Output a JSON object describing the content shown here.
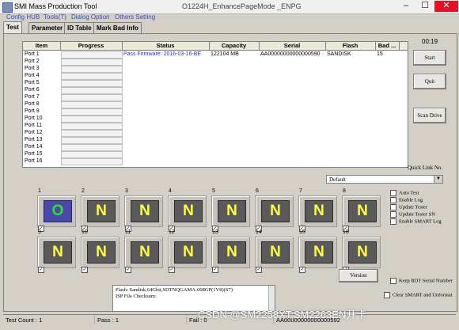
{
  "window": {
    "title": "SMI Mass Production Tool",
    "subtitle": "O1224H_EnhancePageMode      _ENPG"
  },
  "menu": [
    "Config HUB",
    "Tools(T)",
    "Dialog Option",
    "Others Setting"
  ],
  "tabs": [
    "Test",
    "Parameter",
    "ID Table",
    "Mark Bad Info"
  ],
  "table": {
    "headers": [
      "Item",
      "Progress",
      "Status",
      "Capacity",
      "Serial",
      "Flash",
      "Bad ..."
    ],
    "rows": [
      {
        "item": "Port 1",
        "status": "Pass   Firmware: 2016-03-16-BE",
        "capacity": "122104 MB",
        "serial": "AA00000000000000590",
        "flash": "SANDISK",
        "bad": "15"
      },
      {
        "item": "Port 2"
      },
      {
        "item": "Port 3"
      },
      {
        "item": "Port 4"
      },
      {
        "item": "Port 5"
      },
      {
        "item": "Port 6"
      },
      {
        "item": "Port 7"
      },
      {
        "item": "Port 8"
      },
      {
        "item": "Port 9"
      },
      {
        "item": "Port 10"
      },
      {
        "item": "Port 11"
      },
      {
        "item": "Port 12"
      },
      {
        "item": "Port 13"
      },
      {
        "item": "Port 14"
      },
      {
        "item": "Port 15"
      },
      {
        "item": "Port 16"
      }
    ]
  },
  "elapsed": "00:19",
  "buttons": {
    "start": "Start",
    "quit": "Quit",
    "scan": "Scan Drive",
    "version": "Version"
  },
  "quicklink": {
    "label": "Quick Link No.",
    "selected": "Default"
  },
  "slots": [
    {
      "num": "1",
      "glyph": "O",
      "state": "pass"
    },
    {
      "num": "2",
      "glyph": "N"
    },
    {
      "num": "3",
      "glyph": "N"
    },
    {
      "num": "4",
      "glyph": "N"
    },
    {
      "num": "5",
      "glyph": "N"
    },
    {
      "num": "6",
      "glyph": "N"
    },
    {
      "num": "7",
      "glyph": "N"
    },
    {
      "num": "8",
      "glyph": "N"
    },
    {
      "num": "9",
      "glyph": "N"
    },
    {
      "num": "10",
      "glyph": "N"
    },
    {
      "num": "11",
      "glyph": "N"
    },
    {
      "num": "12",
      "glyph": "N"
    },
    {
      "num": "13",
      "glyph": "N"
    },
    {
      "num": "14",
      "glyph": "N"
    },
    {
      "num": "15",
      "glyph": "N"
    },
    {
      "num": "16",
      "glyph": "N"
    }
  ],
  "options": [
    "Auto Test",
    "Enable Log",
    "Update Tester",
    "Update Tester SN",
    "Enable SMART Log"
  ],
  "options_bottom": [
    "Keep RDT Serial Number",
    "Clear SMART and Unformat"
  ],
  "log": [
    "Flash: Sandisk,64Gbit,SDTNQGAMA-008GP(1V8)(S7)",
    "ISP File Checksum:"
  ],
  "status": {
    "test_count": "Test Count : 1",
    "pass": "Pass : 1",
    "fail": "Fail : 0",
    "serial": "AA00000000000000592"
  },
  "watermark": "CSDN @SM2258XT,SM2263EN开卡"
}
